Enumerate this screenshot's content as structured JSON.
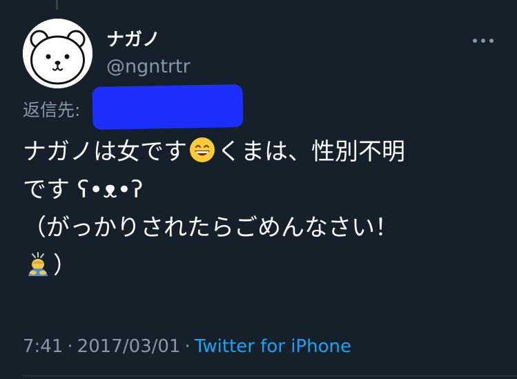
{
  "author": {
    "display_name": "ナガノ",
    "handle": "@ngntrtr"
  },
  "reply": {
    "label": "返信先:"
  },
  "tweet": {
    "line1_a": "ナガノは女です",
    "line1_b": "くまは、性別不明",
    "line2": "です ʕ•ᴥ•ʔ",
    "line3": "（がっかりされたらごめんなさい！",
    "line4_end": "）"
  },
  "meta": {
    "time": "7:41",
    "separator": "·",
    "date": "2017/03/01",
    "source": "Twitter for iPhone"
  },
  "icons": {
    "avatar": "bear-avatar",
    "more": "more-horizontal-icon",
    "emoji_1": "grinning-face-emoji",
    "emoji_2": "person-bowing-emoji"
  },
  "colors": {
    "background": "#15202b",
    "secondary_text": "#8899a6",
    "link": "#1da1f2",
    "redaction": "#1d2fff"
  }
}
